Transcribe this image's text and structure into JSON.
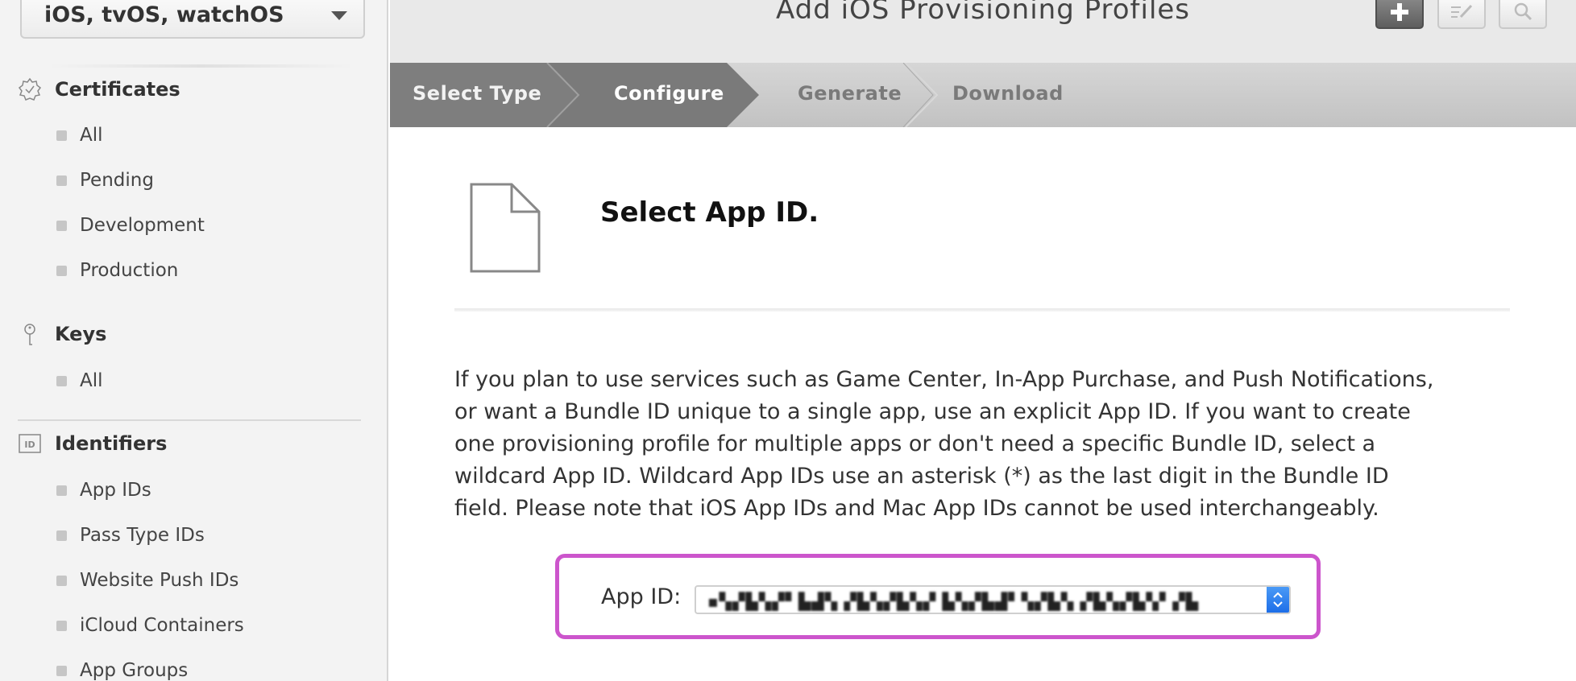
{
  "sidebar": {
    "platform": "iOS, tvOS, watchOS",
    "sections": [
      {
        "title": "Certificates",
        "icon": "certificate-badge-icon",
        "items": [
          "All",
          "Pending",
          "Development",
          "Production"
        ]
      },
      {
        "title": "Keys",
        "icon": "key-icon",
        "items": [
          "All"
        ]
      },
      {
        "title": "Identifiers",
        "icon": "id-icon",
        "items": [
          "App IDs",
          "Pass Type IDs",
          "Website Push IDs",
          "iCloud Containers",
          "App Groups"
        ]
      }
    ]
  },
  "header": {
    "title": "Add iOS Provisioning Profiles",
    "tools": [
      "add-icon",
      "edit-icon",
      "search-icon"
    ]
  },
  "steps": [
    "Select Type",
    "Configure",
    "Generate",
    "Download"
  ],
  "content": {
    "section_title": "Select App ID.",
    "description": "If you plan to use services such as Game Center, In-App Purchase, and Push Notifications, or want a Bundle ID unique to a single app, use an explicit App ID. If you want to create one provisioning profile for multiple apps or don't need a specific Bundle ID, select a wildcard App ID. Wildcard App IDs use an asterisk (*) as the last digit in the Bundle ID field. Please note that iOS App IDs and Mac App IDs cannot be used interchangeably.",
    "app_id_label": "App ID:",
    "app_id_value": "▪▚▞▙▚▞▘▙▟▚ ▞▙▚▞▙▚▞ ▙▚▞▙▟▘▚▞▙▚ ▞▙▚▞▙▚▘▞▙"
  },
  "colors": {
    "highlight": "#cc55cc",
    "step_active": "#7e7e7e",
    "step_inactive": "#c8c8c8"
  }
}
